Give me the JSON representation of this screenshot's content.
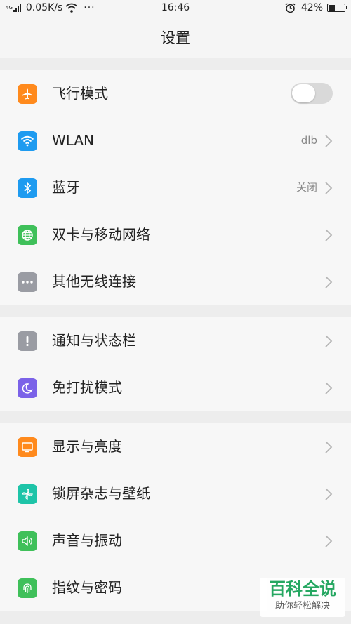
{
  "status_bar": {
    "network_type": "4G",
    "speed": "0.05K/s",
    "more": "···",
    "time": "16:46",
    "battery_percent": "42%",
    "battery_level": 0.42
  },
  "header": {
    "title": "设置"
  },
  "colors": {
    "orange": "#ff8a1d",
    "blue": "#1e9bf0",
    "green": "#3fc05a",
    "gray": "#9a9ca3",
    "purple": "#7b62e8",
    "teal": "#1ec4a8"
  },
  "groups": [
    {
      "items": [
        {
          "label": "飞行模式",
          "icon": "airplane-icon",
          "toggle_on": false
        },
        {
          "label": "WLAN",
          "icon": "wifi-icon",
          "value": "dlb"
        },
        {
          "label": "蓝牙",
          "icon": "bluetooth-icon",
          "value": "关闭"
        },
        {
          "label": "双卡与移动网络",
          "icon": "globe-icon"
        },
        {
          "label": "其他无线连接",
          "icon": "more-icon"
        }
      ]
    },
    {
      "items": [
        {
          "label": "通知与状态栏",
          "icon": "notification-icon"
        },
        {
          "label": "免打扰模式",
          "icon": "moon-icon"
        }
      ]
    },
    {
      "items": [
        {
          "label": "显示与亮度",
          "icon": "display-icon"
        },
        {
          "label": "锁屏杂志与壁纸",
          "icon": "pinwheel-icon"
        },
        {
          "label": "声音与振动",
          "icon": "speaker-icon"
        },
        {
          "label": "指纹与密码",
          "icon": "fingerprint-icon"
        }
      ]
    }
  ],
  "watermark": {
    "title": "百科全说",
    "subtitle": "助你轻松解决"
  }
}
